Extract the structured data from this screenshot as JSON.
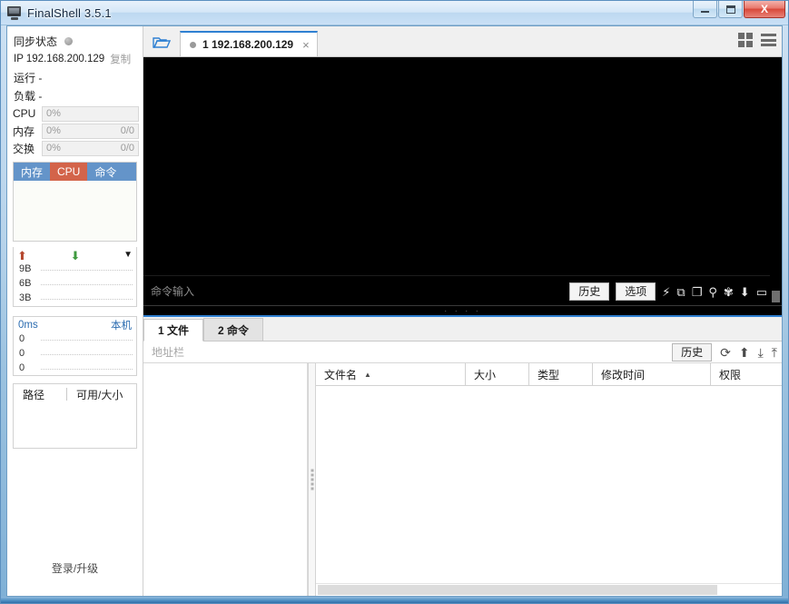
{
  "window": {
    "title": "FinalShell 3.5.1",
    "icon": "monitor-icon",
    "minimize": "–",
    "maximize": "□",
    "close": "X"
  },
  "sidebar": {
    "sync_label": "同步状态",
    "ip_label": "IP 192.168.200.129",
    "copy_label": "复制",
    "run_label": "运行 -",
    "load_label": "负载 -",
    "meters": [
      {
        "name": "CPU",
        "value": "0%",
        "right": ""
      },
      {
        "name": "内存",
        "value": "0%",
        "right": "0/0"
      },
      {
        "name": "交换",
        "value": "0%",
        "right": "0/0"
      }
    ],
    "proc_tabs": [
      {
        "label": "内存",
        "active": false
      },
      {
        "label": "CPU",
        "active": true
      },
      {
        "label": "命令",
        "active": false
      }
    ],
    "net_graph": {
      "up_icon": "arrow-up-icon",
      "down_icon": "arrow-down-icon",
      "menu_icon": "chevron-down-icon",
      "labels": [
        "9B",
        "6B",
        "3B"
      ]
    },
    "ping_graph": {
      "latency": "0ms",
      "host": "本机",
      "labels": [
        "0",
        "0",
        "0"
      ]
    },
    "disk": {
      "col_path": "路径",
      "col_avail": "可用/大小"
    },
    "footer": "登录/升级"
  },
  "main": {
    "folder_icon": "open-folder-icon",
    "tabs": [
      {
        "label": "1 192.168.200.129",
        "close": "×",
        "active": true
      }
    ],
    "view_buttons": [
      {
        "name": "grid-view-icon"
      },
      {
        "name": "list-view-icon"
      }
    ],
    "terminal": {
      "content": "",
      "command_placeholder": "命令输入",
      "buttons": [
        {
          "label": "历史"
        },
        {
          "label": "选项"
        }
      ],
      "icons": [
        {
          "name": "lightning-icon",
          "glyph": "⚡"
        },
        {
          "name": "copy-icon",
          "glyph": "⧉"
        },
        {
          "name": "paste-icon",
          "glyph": "❐"
        },
        {
          "name": "search-icon",
          "glyph": "⚲"
        },
        {
          "name": "gear-icon",
          "glyph": "✾"
        },
        {
          "name": "download-icon",
          "glyph": "⬇"
        },
        {
          "name": "window-icon",
          "glyph": "▭"
        }
      ]
    },
    "lower": {
      "tabs": [
        {
          "label": "1 文件",
          "active": true
        },
        {
          "label": "2 命令",
          "active": false
        }
      ],
      "address_placeholder": "地址栏",
      "history_button": "历史",
      "toolbar_icons": [
        {
          "name": "refresh-icon",
          "glyph": "⟳"
        },
        {
          "name": "upload-arrow-icon",
          "glyph": "⬆"
        },
        {
          "name": "download-file-icon",
          "glyph": "⤓"
        },
        {
          "name": "upload-file-icon",
          "glyph": "⤒"
        }
      ],
      "columns": [
        {
          "label": "文件名",
          "sort": "▲",
          "width": 165
        },
        {
          "label": "大小",
          "sort": "",
          "width": 70
        },
        {
          "label": "类型",
          "sort": "",
          "width": 70
        },
        {
          "label": "修改时间",
          "sort": "",
          "width": 130
        },
        {
          "label": "权限",
          "sort": "",
          "width": 100
        }
      ],
      "rows": []
    }
  }
}
